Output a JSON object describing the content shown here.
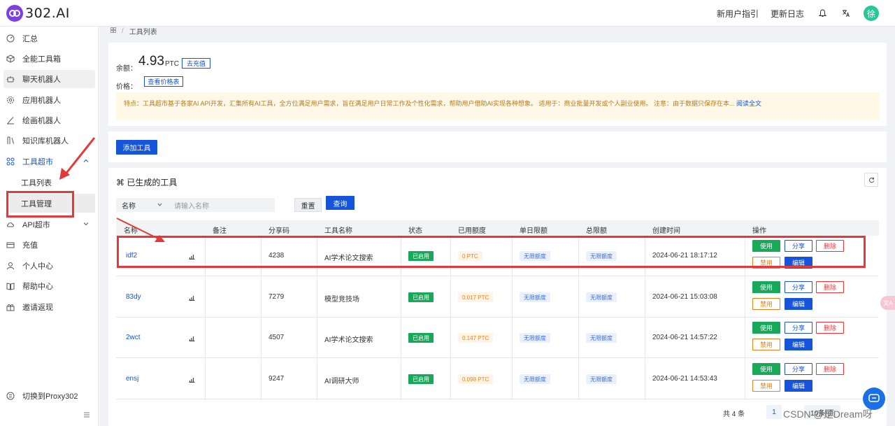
{
  "app": {
    "logo_text": "302.AI"
  },
  "topbar": {
    "guide_label": "新用户指引",
    "changelog_label": "更新日志",
    "avatar_text": "徐"
  },
  "sidebar": {
    "items": [
      {
        "label": "汇总",
        "icon": "gauge-icon"
      },
      {
        "label": "全能工具箱",
        "icon": "box-icon"
      },
      {
        "label": "聊天机器人",
        "icon": "robot-icon"
      },
      {
        "label": "应用机器人",
        "icon": "gear-bot-icon"
      },
      {
        "label": "绘画机器人",
        "icon": "brush-icon"
      },
      {
        "label": "知识库机器人",
        "icon": "books-icon"
      },
      {
        "label": "工具超市",
        "icon": "grid-icon"
      },
      {
        "label": "API超市",
        "icon": "cloud-icon"
      },
      {
        "label": "充值",
        "icon": "wallet-icon"
      },
      {
        "label": "个人中心",
        "icon": "user-icon"
      },
      {
        "label": "帮助中心",
        "icon": "book-icon"
      },
      {
        "label": "邀请返现",
        "icon": "gift-icon"
      }
    ],
    "sub_items": [
      "工具列表",
      "工具管理"
    ],
    "proxy_label": "切换到Proxy302"
  },
  "breadcrumb": {
    "current": "工具列表"
  },
  "account": {
    "balance_label": "余额：",
    "balance_value": "4.93",
    "balance_unit": "PTC",
    "recharge_label": "去充值",
    "price_label": "价格：",
    "price_table_label": "查看价格表",
    "notice": "特点：工具超市基于各家AI API开发，汇集所有AI工具，全方位满足用户需求，旨在满足用户日常工作及个性化需求，帮助用户借助AI实现各种想象。 适用于：商业批量开发或个人副业使用。 注意：由于数据只保存在本...",
    "notice_more": "阅读全文"
  },
  "add_tool_label": "添加工具",
  "tools": {
    "title": "⌘ 已生成的工具",
    "filter_field": "名称",
    "filter_placeholder": "请输入名称",
    "reset_label": "重置",
    "query_label": "查询",
    "columns": [
      "名称",
      "备注",
      "分享码",
      "工具名称",
      "状态",
      "已用额度",
      "单日限额",
      "总限额",
      "创建时间",
      "操作"
    ],
    "rows": [
      {
        "name": "idf2",
        "note": "",
        "code": "4238",
        "tool": "AI学术论文搜索",
        "status": "已启用",
        "used": "0 PTC",
        "daily": "无限额度",
        "total": "无限额度",
        "created": "2024-06-21 18:17:12"
      },
      {
        "name": "83dy",
        "note": "",
        "code": "7279",
        "tool": "模型竞技场",
        "status": "已启用",
        "used": "0.017 PTC",
        "daily": "无限额度",
        "total": "无限额度",
        "created": "2024-06-21 15:03:08"
      },
      {
        "name": "2wct",
        "note": "",
        "code": "4507",
        "tool": "AI学术论文搜索",
        "status": "已启用",
        "used": "0.147 PTC",
        "daily": "无限额度",
        "total": "无限额度",
        "created": "2024-06-21 14:57:22"
      },
      {
        "name": "ensj",
        "note": "",
        "code": "9247",
        "tool": "AI调研大师",
        "status": "已启用",
        "used": "0.098 PTC",
        "daily": "无限额度",
        "total": "无限额度",
        "created": "2024-06-21 14:53:43"
      }
    ],
    "actions": {
      "use": "使用",
      "share": "分享",
      "delete": "删除",
      "disable": "禁用",
      "edit": "编辑"
    }
  },
  "pager": {
    "total": "共 4 条",
    "page": "1",
    "size": "10条/页"
  },
  "watermark": "CSDN @是Dream呀",
  "colors": {
    "brand": "#1654d9",
    "success": "#19a75a",
    "warning": "#e9821b",
    "danger": "#e33333",
    "annotation": "#e23a3a"
  }
}
